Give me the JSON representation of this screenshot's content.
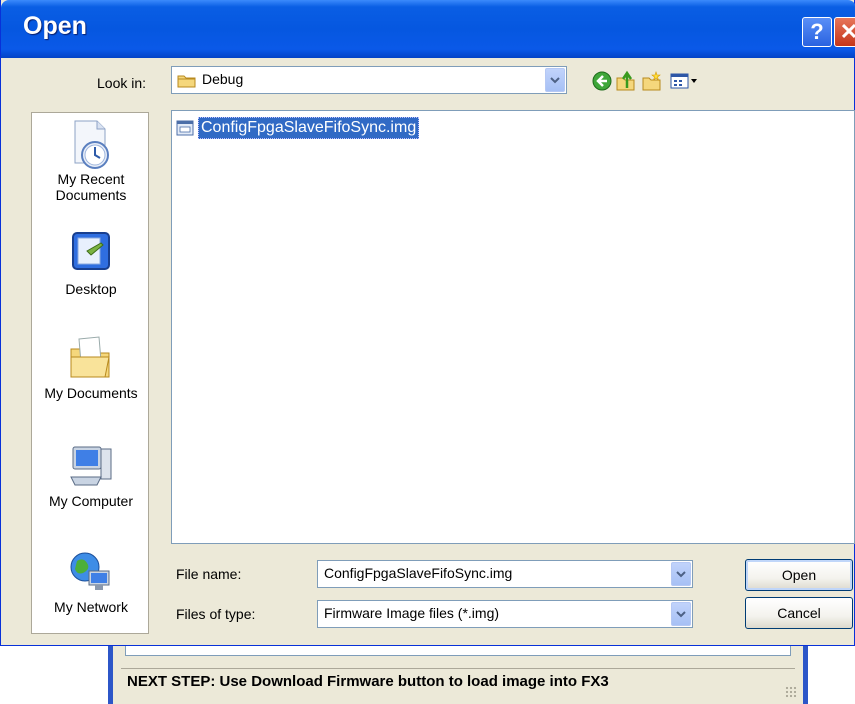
{
  "dialog": {
    "title": "Open",
    "help_label": "?",
    "close_label": "✕"
  },
  "lookin": {
    "label": "Look in:",
    "value": "Debug"
  },
  "toolbar": {
    "icons": [
      "back-icon",
      "up-folder-icon",
      "new-folder-icon",
      "views-menu-icon"
    ]
  },
  "places": [
    {
      "label1": "My Recent",
      "label2": "Documents",
      "icon": "my-recent-documents-icon"
    },
    {
      "label1": "Desktop",
      "label2": "",
      "icon": "desktop-icon"
    },
    {
      "label1": "My Documents",
      "label2": "",
      "icon": "my-documents-icon"
    },
    {
      "label1": "My Computer",
      "label2": "",
      "icon": "my-computer-icon"
    },
    {
      "label1": "My Network",
      "label2": "",
      "icon": "my-network-icon"
    }
  ],
  "files": [
    {
      "name": "ConfigFpgaSlaveFifoSync.img",
      "selected": true
    }
  ],
  "filename": {
    "label": "File name:",
    "value": "ConfigFpgaSlaveFifoSync.img"
  },
  "filetype": {
    "label": "Files of type:",
    "value": "Firmware Image files (*.img)"
  },
  "buttons": {
    "open": "Open",
    "cancel": "Cancel"
  },
  "background_app": {
    "status_text": "NEXT STEP: Use Download Firmware button to load image into FX3"
  },
  "colors": {
    "titlebar": "#0657e0",
    "selection": "#316ac5",
    "dialog_bg": "#ece9d8"
  }
}
